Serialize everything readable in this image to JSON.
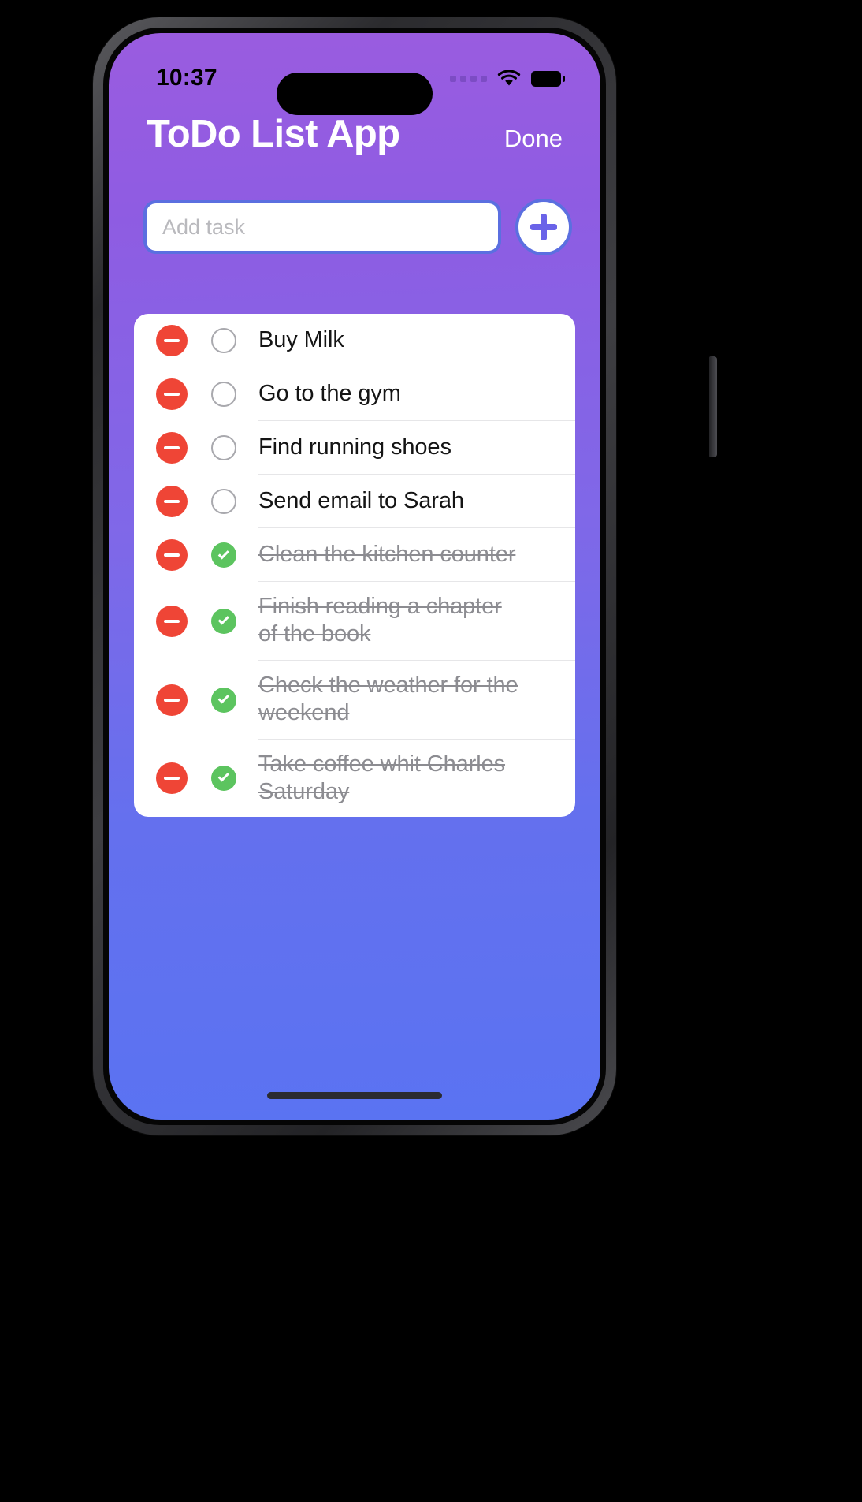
{
  "status_bar": {
    "time": "10:37",
    "signal_icon": "signal-dots-icon",
    "wifi_icon": "wifi-icon",
    "battery_icon": "battery-full-icon"
  },
  "header": {
    "title": "ToDo List App",
    "done_label": "Done"
  },
  "add_bar": {
    "input_value": "",
    "input_placeholder": "Add task",
    "add_icon": "plus-icon"
  },
  "colors": {
    "gradient_top": "#9A5CE0",
    "gradient_bottom": "#5A73F2",
    "delete_red": "#EF4536",
    "check_green": "#5CC45F",
    "border_blue": "#5B6FE0",
    "plus_purple": "#6A63E8",
    "card_white": "#FFFFFF",
    "done_text_gray": "#8C8C91"
  },
  "tasks": [
    {
      "text": "Buy Milk",
      "completed": false
    },
    {
      "text": "Go to the gym",
      "completed": false
    },
    {
      "text": "Find running shoes",
      "completed": false
    },
    {
      "text": "Send email to Sarah",
      "completed": false
    },
    {
      "text": "Clean the kitchen counter",
      "completed": true
    },
    {
      "text": "Finish reading a chapter of the book",
      "completed": true
    },
    {
      "text": "Check the weather for the weekend",
      "completed": true
    },
    {
      "text": "Take coffee whit Charles Saturday",
      "completed": true
    }
  ]
}
